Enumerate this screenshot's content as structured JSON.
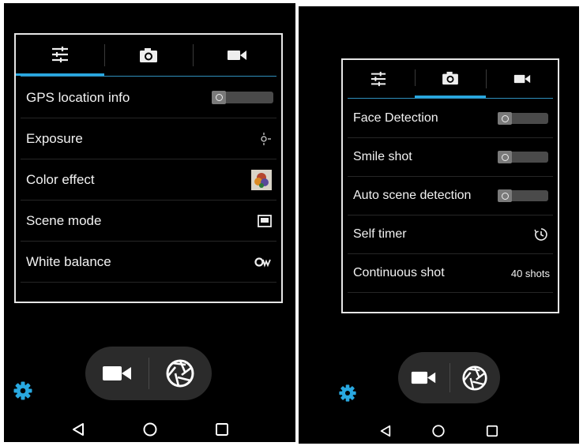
{
  "left_screen": {
    "tabs": [
      {
        "name": "settings-sliders-tab",
        "icon": "sliders-icon",
        "active": true
      },
      {
        "name": "photo-tab",
        "icon": "camera-icon",
        "active": false
      },
      {
        "name": "video-tab",
        "icon": "video-camera-icon",
        "active": false
      }
    ],
    "settings": [
      {
        "label": "GPS location info",
        "control": "toggle",
        "state": "off"
      },
      {
        "label": "Exposure",
        "control": "icon",
        "icon": "exposure-icon"
      },
      {
        "label": "Color effect",
        "control": "icon",
        "icon": "color-effect-thumbnail-icon"
      },
      {
        "label": "Scene mode",
        "control": "icon",
        "icon": "scene-mode-icon"
      },
      {
        "label": "White balance",
        "control": "icon",
        "icon": "white-balance-auto-icon"
      }
    ]
  },
  "right_screen": {
    "tabs": [
      {
        "name": "settings-sliders-tab",
        "icon": "sliders-icon",
        "active": false
      },
      {
        "name": "photo-tab",
        "icon": "camera-icon",
        "active": true
      },
      {
        "name": "video-tab",
        "icon": "video-camera-icon",
        "active": false
      }
    ],
    "settings": [
      {
        "label": "Face Detection",
        "control": "toggle",
        "state": "off"
      },
      {
        "label": "Smile shot",
        "control": "toggle",
        "state": "off"
      },
      {
        "label": "Auto scene detection",
        "control": "toggle",
        "state": "off"
      },
      {
        "label": "Self timer",
        "control": "icon",
        "icon": "timer-icon"
      },
      {
        "label": "Continuous shot",
        "control": "value",
        "value": "40 shots"
      }
    ]
  },
  "capture_bar": {
    "video_icon": "video-record-icon",
    "shutter_icon": "shutter-icon"
  },
  "settings_icon": "gear-icon",
  "nav_bar": {
    "back": "back-icon",
    "home": "home-icon",
    "recents": "recents-icon"
  },
  "colors": {
    "accent": "#29a8e0",
    "background": "#000000",
    "panel_border": "#e6e6e6",
    "toggle_track": "#4a4a4a"
  }
}
